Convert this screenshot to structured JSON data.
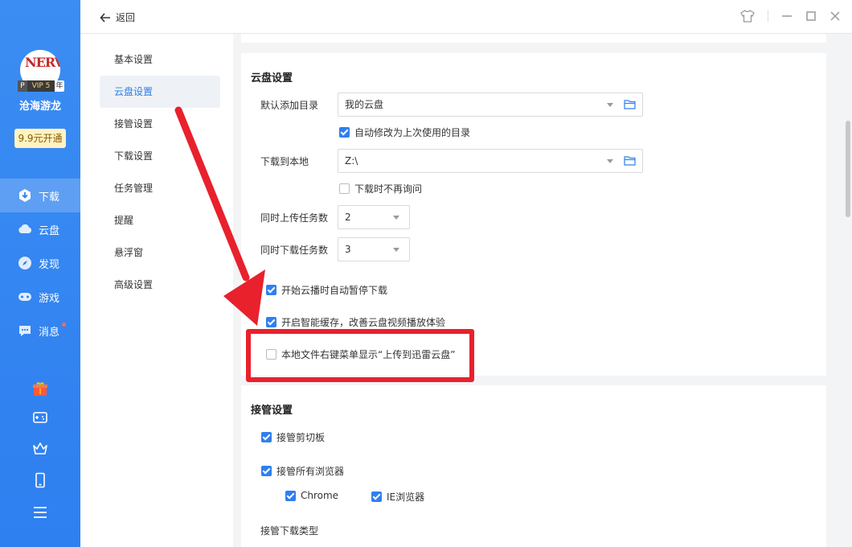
{
  "sidebar": {
    "username": "沧海游龙",
    "vip": {
      "p": "P",
      "label": "VIP 5",
      "year": "年"
    },
    "avatar_text": "NERV",
    "buy_label": "9.9元开通",
    "nav": [
      {
        "label": "下载",
        "icon": "download-icon"
      },
      {
        "label": "云盘",
        "icon": "cloud-icon"
      },
      {
        "label": "发现",
        "icon": "compass-icon"
      },
      {
        "label": "游戏",
        "icon": "gamepad-icon"
      },
      {
        "label": "消息",
        "icon": "message-icon"
      }
    ],
    "bottom_icons": [
      "gift-icon",
      "game-controller-icon",
      "crown-icon",
      "phone-icon",
      "menu-icon"
    ]
  },
  "topbar": {
    "back_label": "返回"
  },
  "subnav": [
    "基本设置",
    "云盘设置",
    "接管设置",
    "下载设置",
    "任务管理",
    "提醒",
    "悬浮窗",
    "高级设置"
  ],
  "cloud": {
    "title": "云盘设置",
    "default_dir_label": "默认添加目录",
    "default_dir_value": "我的云盘",
    "auto_modify": "自动修改为上次使用的目录",
    "local_label": "下载到本地",
    "local_value": "Z:\\",
    "no_ask": "下载时不再询问",
    "upload_label": "同时上传任务数",
    "upload_value": "2",
    "download_label": "同时下载任务数",
    "download_value": "3",
    "pause_on_play": "开始云播时自动暂停下载",
    "smart_cache": "开启智能缓存，改善云盘视频播放体验",
    "context_menu": "本地文件右键菜单显示“上传到迅雷云盘”"
  },
  "takeover": {
    "title": "接管设置",
    "clipboard": "接管剪切板",
    "all_browsers": "接管所有浏览器",
    "chrome": "Chrome",
    "ie": "IE浏览器",
    "types_label": "接管下载类型"
  },
  "colors": {
    "accent": "#2f7ff0",
    "highlight": "#e8212d"
  }
}
